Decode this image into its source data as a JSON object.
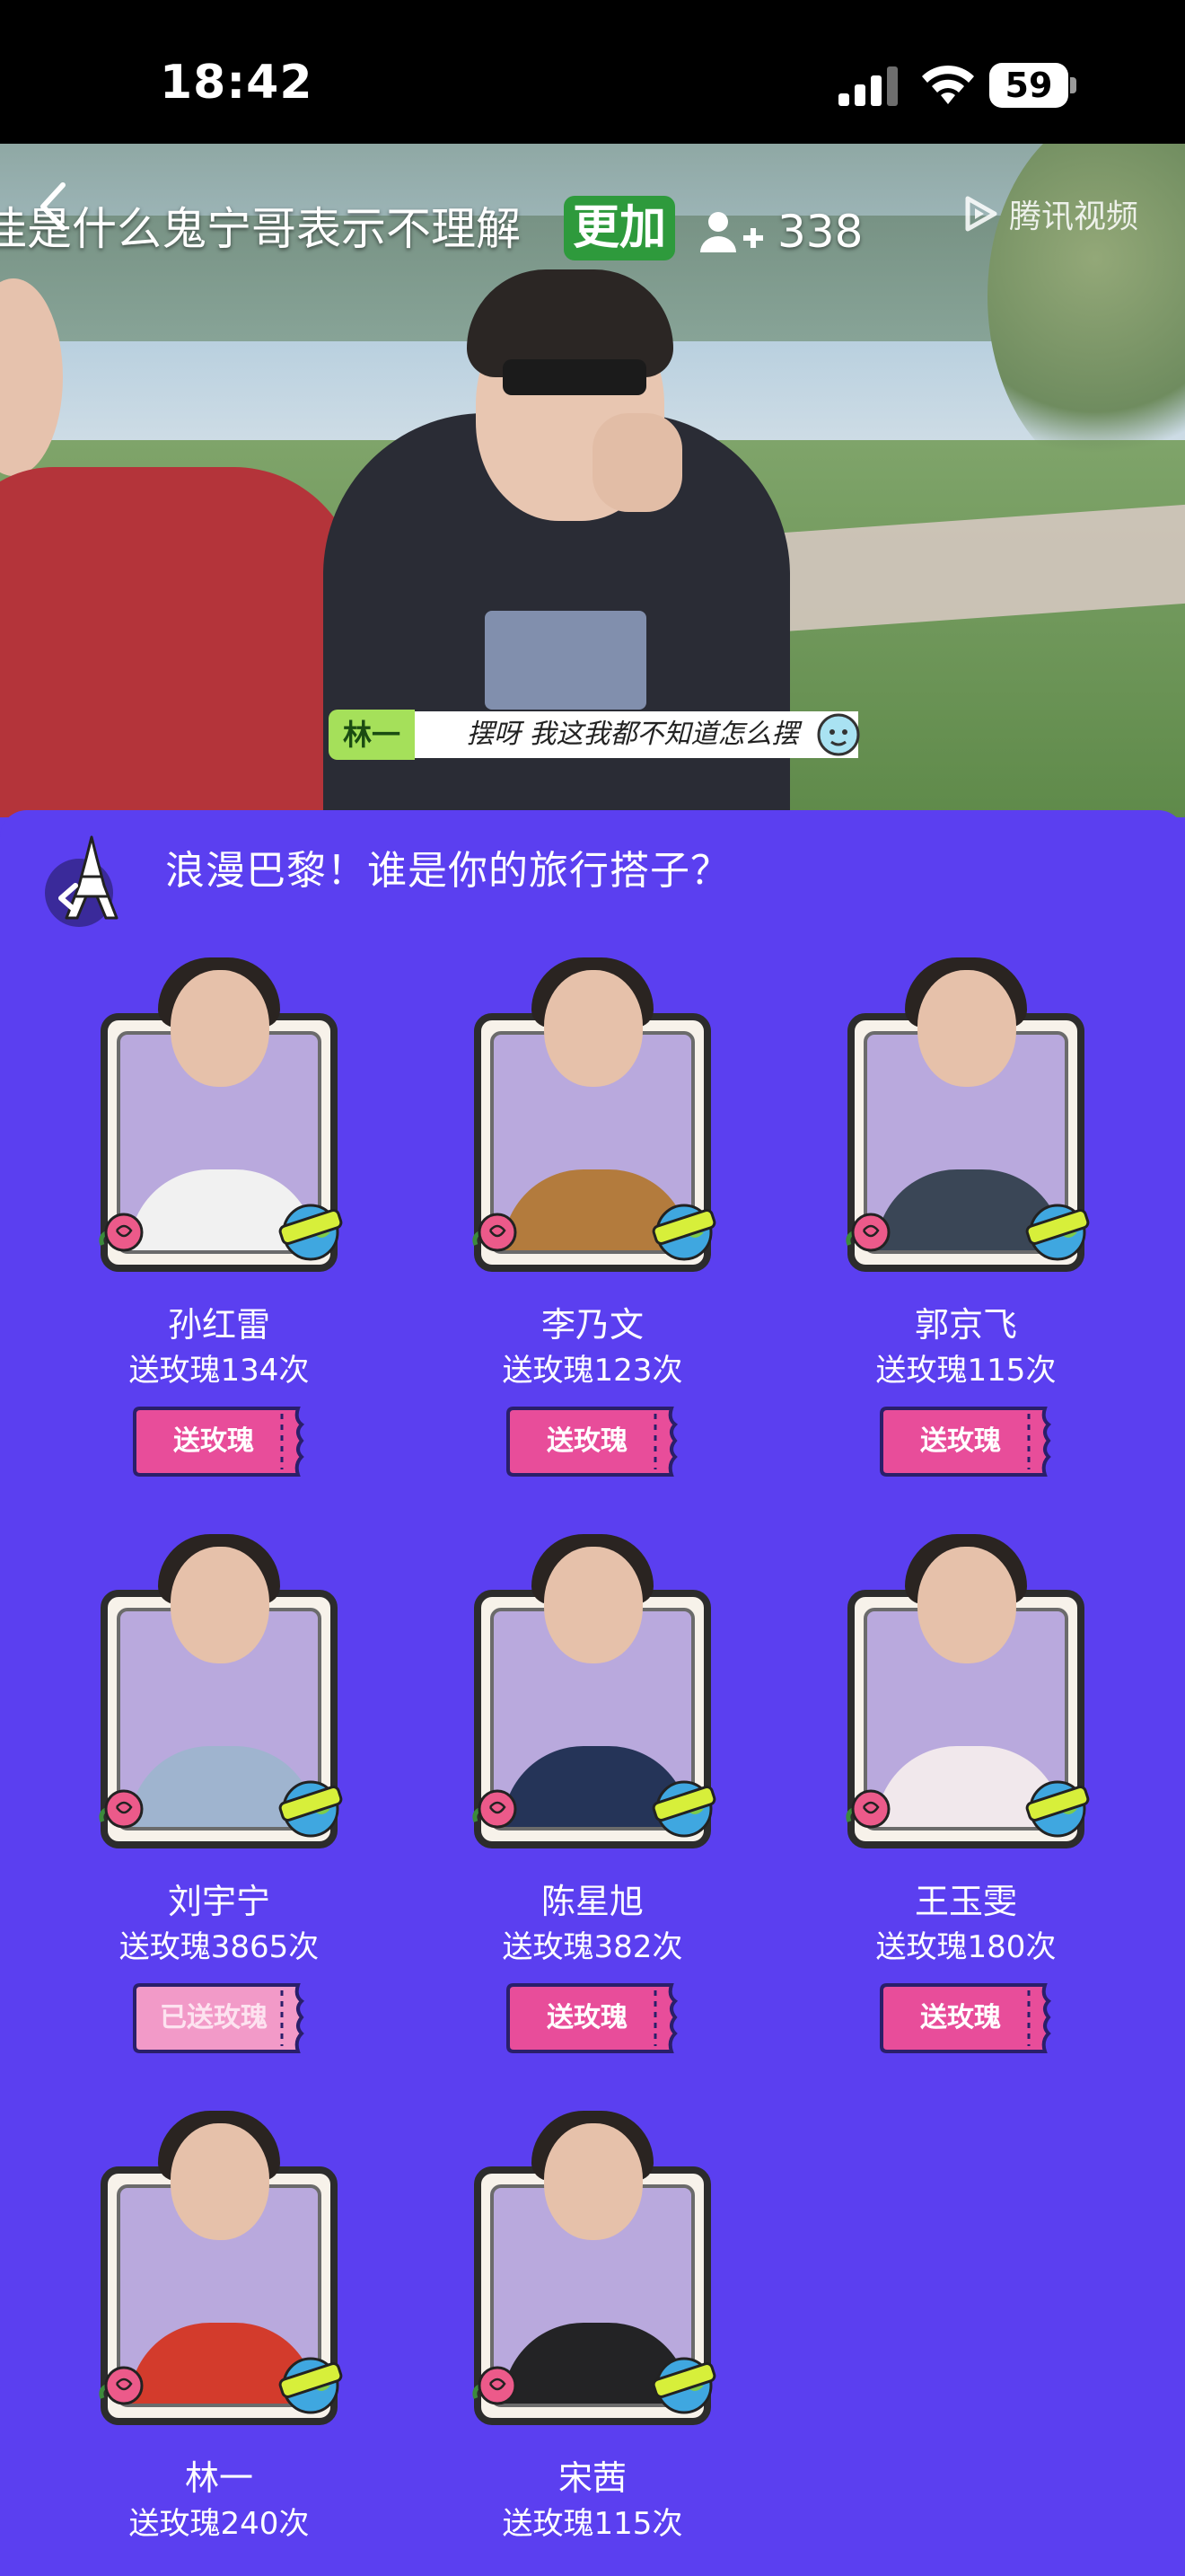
{
  "status_bar": {
    "time": "18:42",
    "battery": "59"
  },
  "video": {
    "danmaku": "洼是什么鬼宁哥表示不理解",
    "danmaku_highlight": "更加",
    "viewer_count": "338",
    "brand": "腾讯视频",
    "subtitle_tag": "林一",
    "subtitle_text": "摆呀 我这我都不知道怎么摆"
  },
  "panel": {
    "title": "浪漫巴黎！谁是你的旅行搭子？",
    "candidates": [
      {
        "name": "孙红雷",
        "count": "送玫瑰134次",
        "button": "送玫瑰",
        "sent": false,
        "shirt": "#f1f1f1"
      },
      {
        "name": "李乃文",
        "count": "送玫瑰123次",
        "button": "送玫瑰",
        "sent": false,
        "shirt": "#b37b3d"
      },
      {
        "name": "郭京飞",
        "count": "送玫瑰115次",
        "button": "送玫瑰",
        "sent": false,
        "shirt": "#3a4656"
      },
      {
        "name": "刘宇宁",
        "count": "送玫瑰3865次",
        "button": "已送玫瑰",
        "sent": true,
        "shirt": "#9fb4cf"
      },
      {
        "name": "陈星旭",
        "count": "送玫瑰382次",
        "button": "送玫瑰",
        "sent": false,
        "shirt": "#253458"
      },
      {
        "name": "王玉雯",
        "count": "送玫瑰180次",
        "button": "送玫瑰",
        "sent": false,
        "shirt": "#f1e8ec"
      },
      {
        "name": "林一",
        "count": "送玫瑰240次",
        "button": "",
        "sent": false,
        "shirt": "#d33b2c"
      },
      {
        "name": "宋茜",
        "count": "送玫瑰115次",
        "button": "",
        "sent": false,
        "shirt": "#232325"
      }
    ]
  },
  "colors": {
    "panel_bg": "#5b3ff0",
    "rose_button": "#e84d9a",
    "rose_button_sent": "#f29ac8",
    "danmaku_highlight_bg": "#2e9a3c"
  },
  "icons": [
    "back-arrow-icon",
    "viewer-count-icon",
    "tencent-video-logo-icon",
    "eiffel-tower-icon",
    "rose-icon",
    "world-badge-icon",
    "signal-icon",
    "wifi-icon",
    "battery-icon"
  ]
}
